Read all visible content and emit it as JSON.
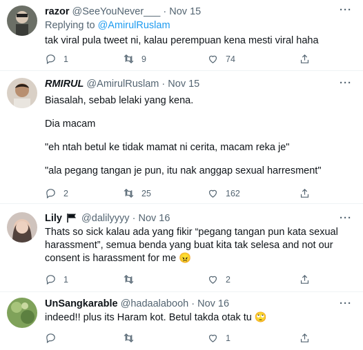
{
  "tweets": [
    {
      "display_name": "razor",
      "handle": "@SeeYouNever___",
      "date": "Nov 15",
      "replying_prefix": "Replying to ",
      "replying_to": "@AmirulRuslam",
      "text": [
        "tak viral pula tweet ni, kalau perempuan kena mesti viral haha"
      ],
      "replies": "1",
      "retweets": "9",
      "likes": "74"
    },
    {
      "display_name": "RMIRUL",
      "handle": "@AmirulRuslam",
      "date": "Nov 15",
      "text": [
        "Biasalah, sebab lelaki yang kena.",
        "Dia macam",
        "\"eh ntah betul ke tidak mamat ni cerita, macam reka je\"",
        "\"ala pegang tangan je pun, itu nak anggap sexual harresment\""
      ],
      "replies": "2",
      "retweets": "25",
      "likes": "162"
    },
    {
      "display_name": "Lily",
      "handle": "@dalilyyyy",
      "date": "Nov 16",
      "text": [
        "Thats so sick kalau ada yang fikir “pegang tangan pun kata sexual harassment”, semua benda yang buat kita tak selesa and not our consent is harassment for me 😠"
      ],
      "replies": "1",
      "retweets": "",
      "likes": "2"
    },
    {
      "display_name": "UnSangkarable",
      "handle": "@hadaalabooh",
      "date": "Nov 16",
      "text": [
        "indeed!! plus its Haram kot. Betul takda otak tu 🙄"
      ],
      "replies": "",
      "retweets": "",
      "likes": "1"
    }
  ],
  "more_glyph": "···",
  "separator": "·",
  "colors": {
    "accent": "#1d9bf0",
    "muted": "#536471",
    "text": "#0f1419"
  },
  "icons": [
    "reply-icon",
    "retweet-icon",
    "like-icon",
    "share-icon",
    "more-icon",
    "flag-icon"
  ]
}
